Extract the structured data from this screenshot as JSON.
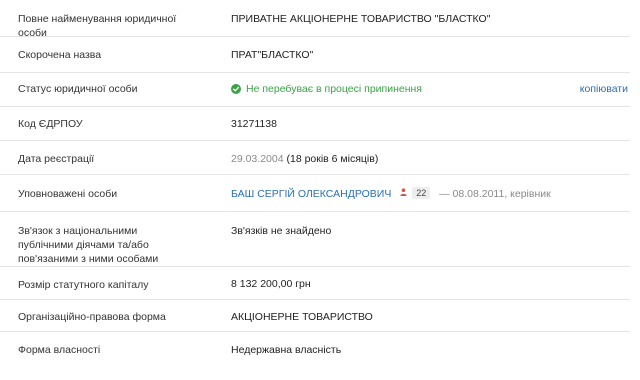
{
  "rows": {
    "full_name": {
      "label": "Повне найменування юридичної особи",
      "value": "ПРИВАТНЕ АКЦІОНЕРНЕ ТОВАРИСТВО \"БЛАСТКО\""
    },
    "short_name": {
      "label": "Скорочена назва",
      "value": "ПРАТ\"БЛАСТКО\""
    },
    "status": {
      "label": "Статус юридичної особи",
      "value": "Не перебуває в процесі припинення",
      "copy_label": "копіювати",
      "icon": "check-circle-icon",
      "color": "#3aa346"
    },
    "edrpou": {
      "label": "Код ЄДРПОУ",
      "value": "31271138"
    },
    "registration": {
      "label": "Дата реєстрації",
      "date": "29.03.2004",
      "duration": "(18 років 6 місяців)"
    },
    "authorized": {
      "label": "Уповноважені особи",
      "person": "БАШ СЕРГІЙ ОЛЕКСАНДРОВИЧ",
      "count": "22",
      "meta": "— 08.08.2011, керівник",
      "icon": "person-icon"
    },
    "pep": {
      "label": "Зв'язок з національними публічними діячами та/або пов'язаними з ними особами",
      "value": "Зв'язків не знайдено"
    },
    "capital": {
      "label": "Розмір статутного капіталу",
      "value": "8 132 200,00 грн"
    },
    "legal_form": {
      "label": "Організаційно-правова форма",
      "value": "АКЦІОНЕРНЕ ТОВАРИСТВО"
    },
    "ownership": {
      "label": "Форма власності",
      "value": "Недержавна власність"
    }
  },
  "colors": {
    "link": "#2a6fb8",
    "status_green": "#3aa346",
    "muted": "#8a8a8a",
    "divider": "#e4e4e4"
  }
}
